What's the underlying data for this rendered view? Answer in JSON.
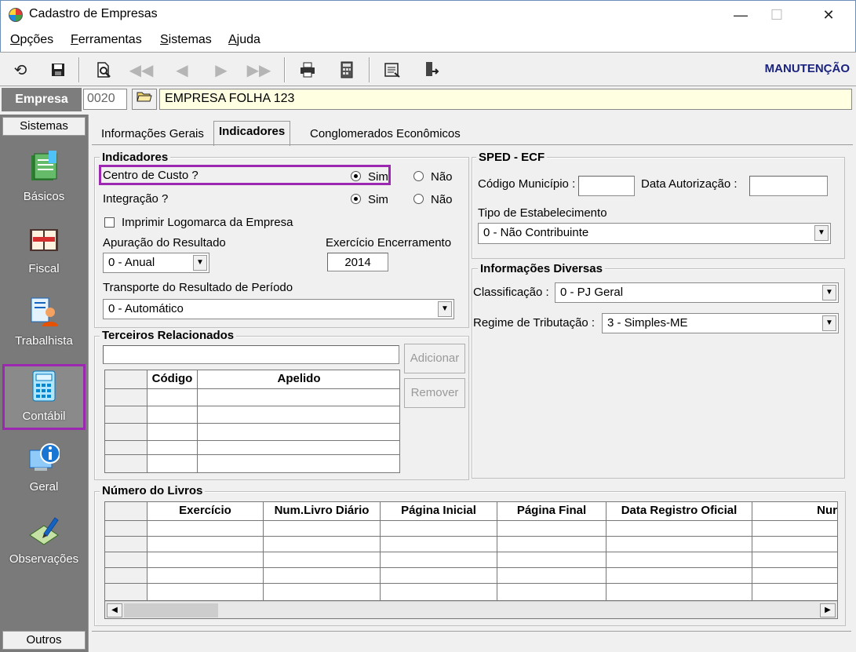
{
  "window": {
    "title": "Cadastro de Empresas",
    "minimize": "—",
    "maximize": "☐",
    "close": "✕"
  },
  "menu": [
    "Opções",
    "Ferramentas",
    "Sistemas",
    "Ajuda"
  ],
  "toolbar": {
    "buttons": [
      "undo-icon",
      "save-icon",
      "preview-icon",
      "first-icon",
      "prev-icon",
      "next-icon",
      "last-icon",
      "print-icon",
      "calculator-icon",
      "report-icon",
      "exit-icon"
    ],
    "mode": "MANUTENÇÃO"
  },
  "empresa": {
    "label": "Empresa",
    "code": "0020",
    "name": "EMPRESA FOLHA 123"
  },
  "sidebar": {
    "top": "Sistemas",
    "bottom": "Outros",
    "items": [
      {
        "label": "Básicos",
        "icon": "book-icon"
      },
      {
        "label": "Fiscal",
        "icon": "ledger-icon"
      },
      {
        "label": "Trabalhista",
        "icon": "worker-icon"
      },
      {
        "label": "Contábil",
        "icon": "calculator-icon",
        "active": true
      },
      {
        "label": "Geral",
        "icon": "info-icon"
      },
      {
        "label": "Observações",
        "icon": "pen-icon"
      }
    ]
  },
  "tabs": [
    "Informações Gerais",
    "Indicadores",
    "Conglomerados Econômicos"
  ],
  "indicadores": {
    "title": "Indicadores",
    "centro_custo": "Centro de Custo ?",
    "integracao": "Integração ?",
    "sim": "Sim",
    "nao": "Não",
    "imprimir_logo": "Imprimir Logomarca da Empresa",
    "apuracao_label": "Apuração do Resultado",
    "apuracao_value": "0 - Anual",
    "exercicio_label": "Exercício Encerramento",
    "exercicio_value": "2014",
    "transporte_label": "Transporte do Resultado de Período",
    "transporte_value": "0 - Automático"
  },
  "terceiros": {
    "title": "Terceiros Relacionados",
    "adicionar": "Adicionar",
    "remover": "Remover",
    "columns": [
      "Código",
      "Apelido"
    ]
  },
  "sped": {
    "title": "SPED - ECF",
    "codigo_municipio": "Código Município :",
    "data_autorizacao": "Data Autorização :",
    "tipo_label": "Tipo de Estabelecimento",
    "tipo_value": "0 - Não Contribuinte"
  },
  "diversas": {
    "title": "Informações Diversas",
    "classificacao_label": "Classificação :",
    "classificacao_value": "0 - PJ Geral",
    "regime_label": "Regime de Tributação :",
    "regime_value": "3 - Simples-ME"
  },
  "livros": {
    "title": "Número do Livros",
    "columns": [
      "Exercício",
      "Num.Livro Diário",
      "Página Inicial",
      "Página Final",
      "Data Registro Oficial",
      "Nur"
    ]
  }
}
